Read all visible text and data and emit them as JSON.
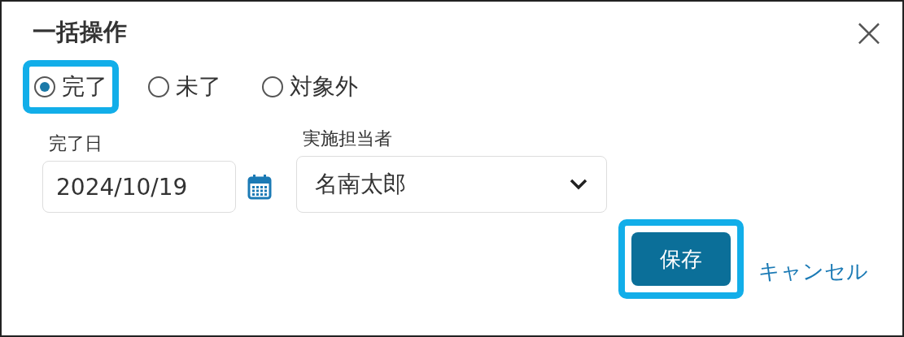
{
  "dialog": {
    "title": "一括操作",
    "close": "×"
  },
  "status_options": [
    {
      "label": "完了",
      "selected": true,
      "highlighted": true
    },
    {
      "label": "未了",
      "selected": false,
      "highlighted": false
    },
    {
      "label": "対象外",
      "selected": false,
      "highlighted": false
    }
  ],
  "date_field": {
    "label": "完了日",
    "value": "2024/10/19"
  },
  "assignee_field": {
    "label": "実施担当者",
    "value": "名南太郎"
  },
  "save_button": {
    "label": "保存",
    "highlighted": true
  },
  "cancel_link": {
    "label": "キャンセル"
  }
}
